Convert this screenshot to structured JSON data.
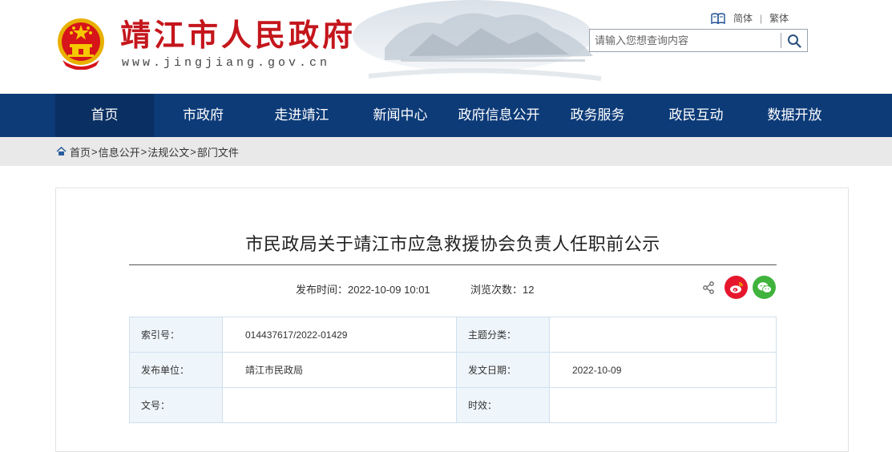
{
  "header": {
    "site_title": "靖江市人民政府",
    "site_url": "www.jingjiang.gov.cn",
    "lang_simplified": "简体",
    "lang_separator": "|",
    "lang_traditional": "繁体",
    "search_placeholder": "请输入您想查询内容"
  },
  "nav": {
    "items": [
      "首页",
      "市政府",
      "走进靖江",
      "新闻中心",
      "政府信息公开",
      "政务服务",
      "政民互动",
      "数据开放"
    ],
    "active_index": 0
  },
  "breadcrumb": {
    "items": [
      "首页",
      "信息公开",
      "法规公文",
      "部门文件"
    ],
    "separator": ">"
  },
  "article": {
    "title": "市民政局关于靖江市应急救援协会负责人任职前公示",
    "publish_label": "发布时间：",
    "publish_time": "2022-10-09 10:01",
    "views_label": "浏览次数：",
    "views_count": "12"
  },
  "info_table": {
    "index_label": "索引号：",
    "index_value": "014437617/2022-01429",
    "topic_label": "主题分类：",
    "topic_value": "",
    "publisher_label": "发布单位：",
    "publisher_value": "靖江市民政局",
    "date_label": "发文日期：",
    "date_value": "2022-10-09",
    "docno_label": "文号：",
    "docno_value": "",
    "validity_label": "时效：",
    "validity_value": ""
  },
  "colors": {
    "nav_bg": "#0d3b78",
    "title_red": "#c4161c",
    "weibo": "#e6162d",
    "wechat": "#3fb33c"
  },
  "icons": [
    "national-emblem",
    "book-icon",
    "search-icon",
    "home-icon",
    "share-icon",
    "weibo-icon",
    "wechat-icon"
  ]
}
